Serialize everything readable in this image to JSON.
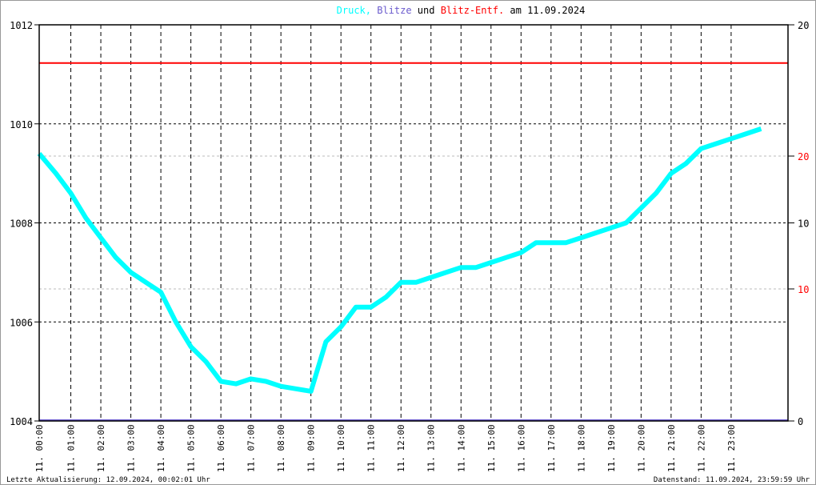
{
  "chart_data": {
    "type": "line",
    "title_parts": [
      {
        "text": "Druck,",
        "color": "#00ffff"
      },
      {
        "text": "Blitze",
        "color": "#6a5acd"
      },
      {
        "text": "und",
        "color": "#000000"
      },
      {
        "text": "Blitz-Entf.",
        "color": "#ff0000"
      },
      {
        "text": "am 11.09.2024",
        "color": "#000000"
      }
    ],
    "left_axis": {
      "ylim": [
        1004,
        1012
      ],
      "ticks": [
        "1004",
        "1006",
        "1008",
        "1010",
        "1012"
      ]
    },
    "right_axis_black": {
      "ylim": [
        0,
        20
      ],
      "ticks": [
        "0",
        "10",
        "20"
      ]
    },
    "right_axis_red": {
      "ylim": [
        0,
        30
      ],
      "ticks": [
        "10",
        "20"
      ]
    },
    "x_ticks": [
      "11. 00:00",
      "11. 01:00",
      "11. 02:00",
      "11. 03:00",
      "11. 04:00",
      "11. 05:00",
      "11. 06:00",
      "11. 07:00",
      "11. 08:00",
      "11. 09:00",
      "11. 10:00",
      "11. 11:00",
      "11. 12:00",
      "11. 13:00",
      "11. 14:00",
      "11. 15:00",
      "11. 16:00",
      "11. 17:00",
      "11. 18:00",
      "11. 19:00",
      "11. 20:00",
      "11. 21:00",
      "11. 22:00",
      "11. 23:00"
    ],
    "series": [
      {
        "name": "Druck",
        "color": "#00ffff",
        "x_hours": [
          0,
          0.5,
          1,
          1.5,
          2,
          2.5,
          3,
          3.5,
          4,
          4.5,
          5,
          5.5,
          6,
          6.5,
          7,
          7.5,
          8,
          8.5,
          9,
          9.5,
          10,
          10.5,
          11,
          11.5,
          12,
          12.5,
          13,
          13.5,
          14,
          14.5,
          15,
          15.5,
          16,
          16.5,
          17,
          17.5,
          18,
          18.5,
          19,
          19.5,
          20,
          20.5,
          21,
          21.5,
          22,
          22.5,
          23,
          23.5,
          24
        ],
        "values": [
          1009.4,
          1009.0,
          1008.6,
          1008.1,
          1007.7,
          1007.3,
          1007.0,
          1006.8,
          1006.6,
          1006.0,
          1005.5,
          1005.2,
          1004.8,
          1004.75,
          1004.85,
          1004.8,
          1004.7,
          1004.65,
          1004.6,
          1005.6,
          1005.9,
          1006.3,
          1006.3,
          1006.5,
          1006.8,
          1006.8,
          1006.9,
          1007.0,
          1007.1,
          1007.1,
          1007.2,
          1007.3,
          1007.4,
          1007.6,
          1007.6,
          1007.6,
          1007.7,
          1007.8,
          1007.9,
          1008.0,
          1008.3,
          1008.6,
          1009.0,
          1009.2,
          1009.5,
          1009.6,
          1009.7,
          1009.8,
          1009.9
        ]
      },
      {
        "name": "Blitze",
        "color": "#6a5acd",
        "axis": "right_black",
        "constant": 0
      },
      {
        "name": "Blitz-Entf.",
        "color": "#ff0000",
        "axis": "right_red",
        "constant": 27
      }
    ]
  },
  "footer": {
    "left": "Letzte Aktualisierung: 12.09.2024, 00:02:01 Uhr",
    "right": "Datenstand: 11.09.2024, 23:59:59 Uhr"
  }
}
